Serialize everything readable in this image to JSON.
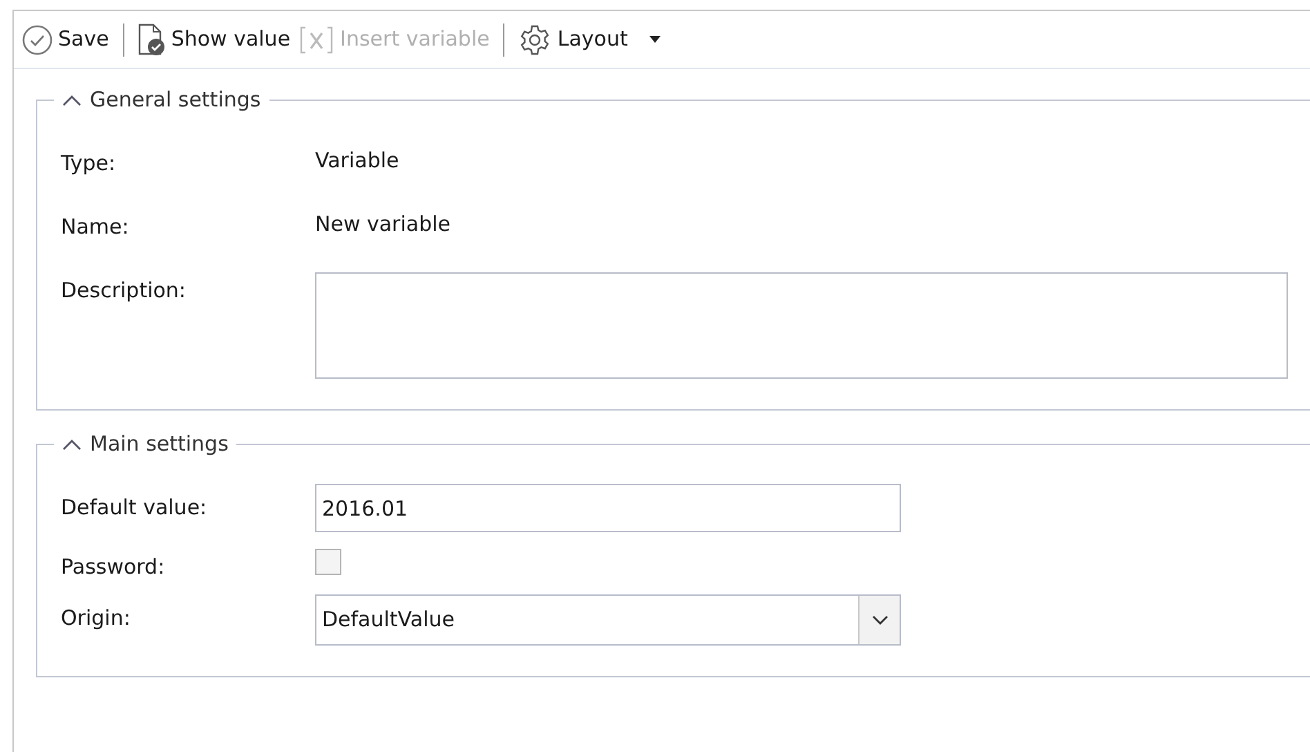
{
  "toolbar": [
    {
      "kind": "save",
      "label": "Save",
      "disabled": false
    },
    {
      "kind": "separator"
    },
    {
      "kind": "show",
      "label": "Show value",
      "disabled": false
    },
    {
      "kind": "insert",
      "label": "Insert variable",
      "disabled": true
    },
    {
      "kind": "separator"
    },
    {
      "kind": "layout",
      "label": "Layout",
      "disabled": false
    }
  ],
  "groups": [
    {
      "title": "General settings",
      "expanded": true,
      "rows": [
        {
          "kind": "text",
          "label": "Type:",
          "value": "Variable"
        },
        {
          "kind": "text",
          "label": "Name:",
          "value": "New variable"
        },
        {
          "kind": "memo",
          "label": "Description:"
        }
      ]
    },
    {
      "title": "Main settings",
      "expanded": true,
      "rows": [
        {
          "kind": "input",
          "label": "Default value:",
          "value": "2016.01"
        },
        {
          "kind": "checkbox",
          "label": "Password:",
          "checked": false
        },
        {
          "kind": "combo",
          "label": "Origin:",
          "value": "DefaultValue"
        }
      ]
    }
  ]
}
